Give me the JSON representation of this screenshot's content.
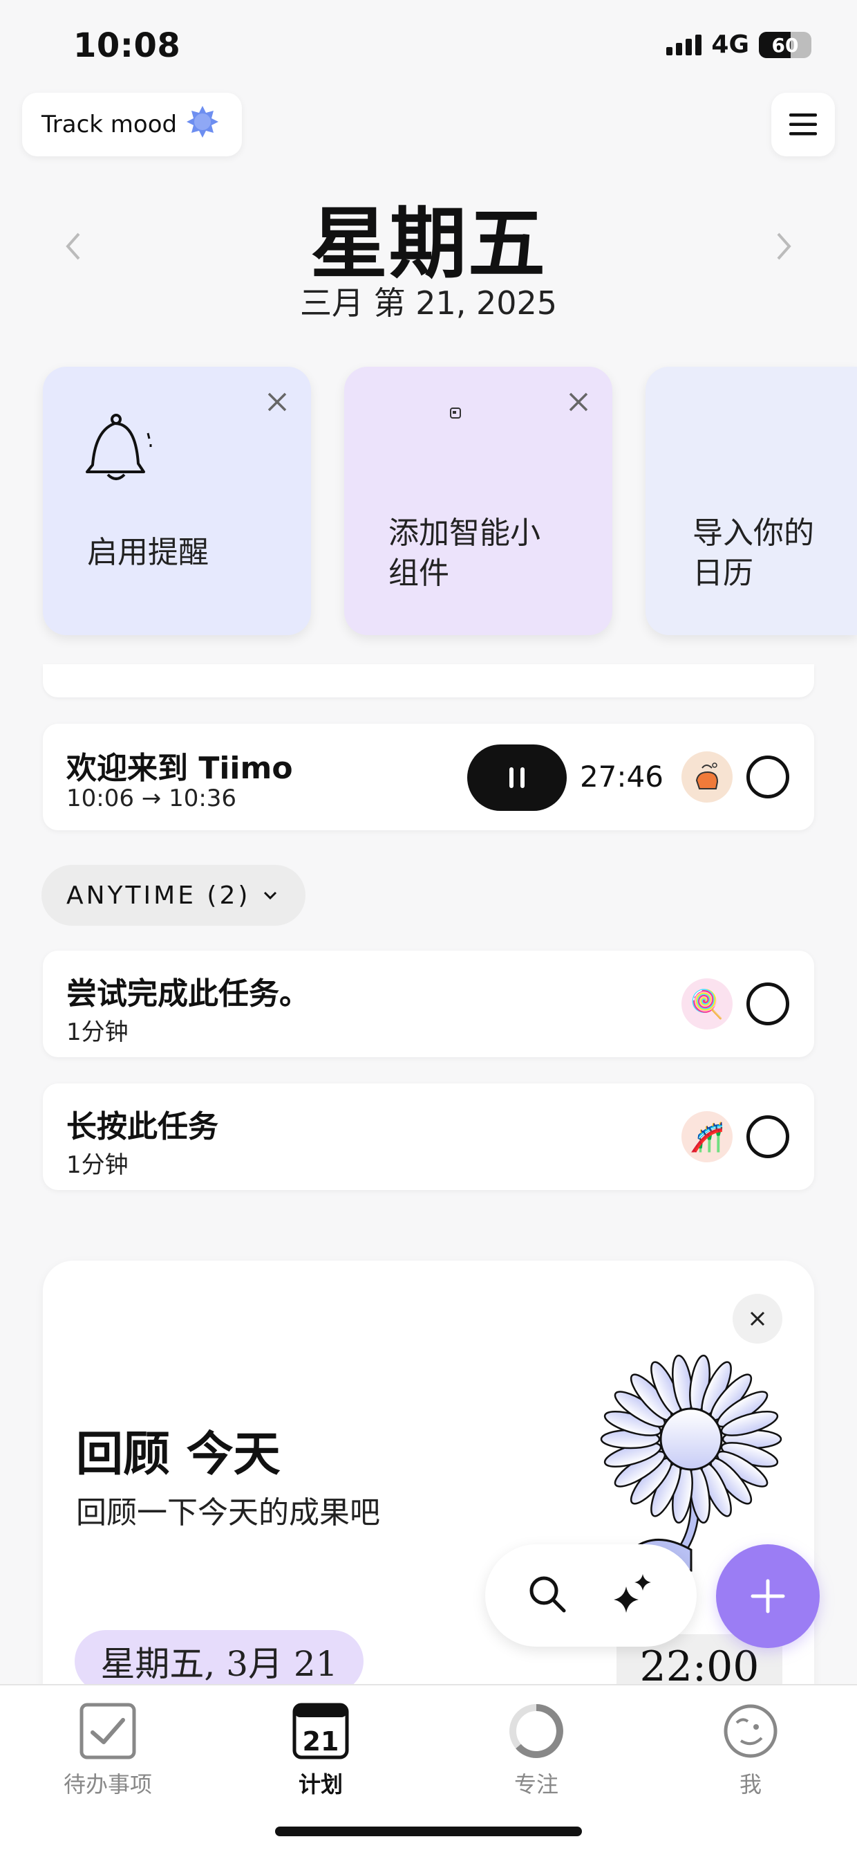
{
  "status": {
    "time": "10:08",
    "network": "4G",
    "battery_percent": 60,
    "battery_label": "60"
  },
  "header": {
    "track_mood_label": "Track mood",
    "menu_icon": "hamburger-icon",
    "day_name": "星期五",
    "date": "三月 第 21, 2025",
    "prev_icon": "chevron-left-icon",
    "next_icon": "chevron-right-icon"
  },
  "cards": [
    {
      "label": "启用提醒",
      "icon": "bell-icon",
      "bg": "#e6e9fd"
    },
    {
      "label": "添加智能小组件",
      "icon": "widget-icon",
      "bg": "#ece3fb"
    },
    {
      "label": "导入你的日历",
      "icon": "calendar-icon",
      "bg": "#eaedfb"
    }
  ],
  "tasks": {
    "current": {
      "title": "欢迎来到 Tiimo",
      "time_range": "10:06 → 10:36",
      "timer": "27:46"
    },
    "anytime_label": "ANYTIME (2)",
    "anytime": [
      {
        "title": "尝试完成此任务。",
        "duration": "1分钟",
        "emoji": "🍭"
      },
      {
        "title": "长按此任务",
        "duration": "1分钟",
        "emoji": "🎢"
      }
    ]
  },
  "review": {
    "title": "回顾 今天",
    "subtitle": "回顾一下今天的成果吧",
    "date_chip": "星期五, 3月 21",
    "time": "22:00"
  },
  "tabbar": [
    {
      "label": "待办事项",
      "icon": "checkbox-icon",
      "active": false
    },
    {
      "label": "计划",
      "icon": "calendar-day-icon",
      "day": "21",
      "active": true
    },
    {
      "label": "专注",
      "icon": "focus-ring-icon",
      "active": false
    },
    {
      "label": "我",
      "icon": "profile-face-icon",
      "active": false
    }
  ],
  "colors": {
    "accent": "#9b7df4",
    "card_blue": "#e6e9fd",
    "card_purple": "#ece3fb",
    "date_chip": "#e6dcfb"
  }
}
